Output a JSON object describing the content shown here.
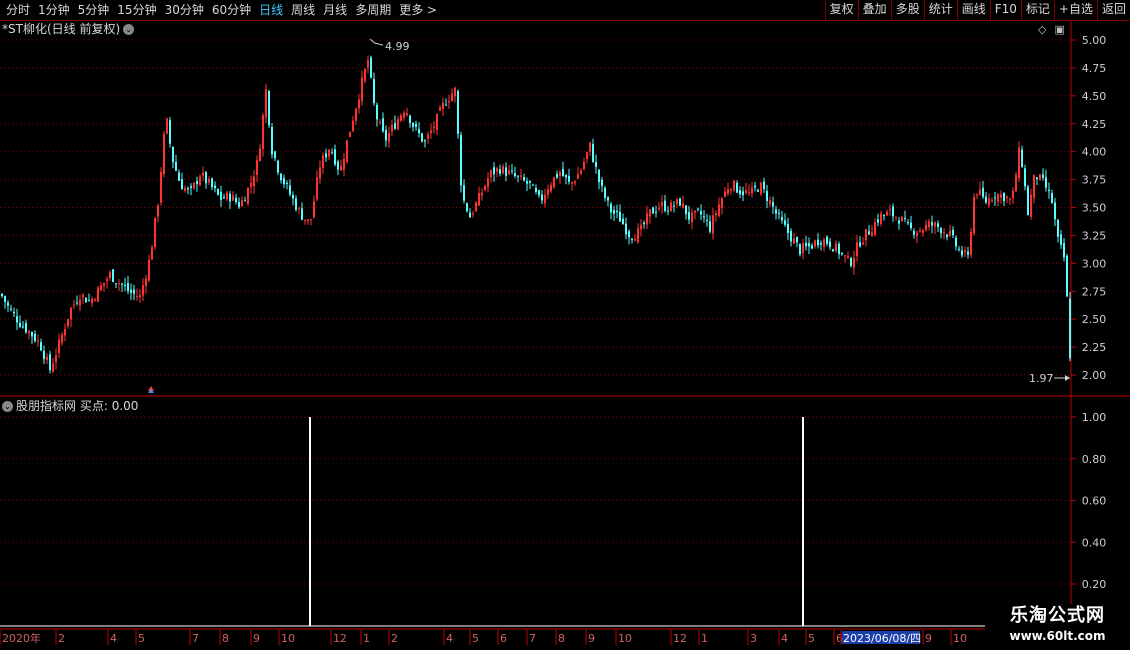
{
  "toolbar": {
    "periods": [
      "分时",
      "1分钟",
      "5分钟",
      "15分钟",
      "30分钟",
      "60分钟",
      "日线",
      "周线",
      "月线",
      "多周期",
      "更多 >"
    ],
    "active": "日线",
    "right_buttons": [
      "复权",
      "叠加",
      "多股",
      "统计",
      "画线",
      "F10",
      "标记",
      "+自选",
      "返回"
    ]
  },
  "main": {
    "title": "*ST柳化(日线 前复权)",
    "chev": "⌄",
    "icons": [
      "diamond-icon",
      "panel-icon"
    ],
    "price_ticks": [
      "5.00",
      "4.75",
      "4.50",
      "4.25",
      "4.00",
      "3.75",
      "3.50",
      "3.25",
      "3.00",
      "2.75",
      "2.50",
      "2.25",
      "2.00"
    ],
    "high_label": "4.99",
    "low_label": "1.97"
  },
  "indicator": {
    "title": "股朋指标网",
    "series_label": "买点: 0.00",
    "ticks": [
      "1.00",
      "0.80",
      "0.60",
      "0.40",
      "0.20"
    ]
  },
  "time_axis": {
    "labels": [
      "2020年",
      "2",
      "4",
      "5",
      "7",
      "8",
      "9",
      "10",
      "12",
      "1",
      "2",
      "4",
      "5",
      "6",
      "7",
      "8",
      "9",
      "10",
      "12",
      "1",
      "3",
      "4",
      "5",
      "6",
      "2023/06/08/四",
      "9",
      "10"
    ]
  },
  "watermark": {
    "line1": "乐淘公式网",
    "line2": "www.60lt.com"
  },
  "colors": {
    "up": "#ff3232",
    "down": "#54ffff",
    "grid": "#8b0000",
    "axis": "#c00000",
    "active": "#3fd0ff"
  },
  "chart_data": {
    "type": "candlestick",
    "ylim": [
      1.97,
      4.99
    ],
    "price_ticks": [
      5.0,
      4.75,
      4.5,
      4.25,
      4.0,
      3.75,
      3.5,
      3.25,
      3.0,
      2.75,
      2.5,
      2.25,
      2.0
    ],
    "close_path": [
      [
        0,
        2.74
      ],
      [
        10,
        2.58
      ],
      [
        20,
        2.47
      ],
      [
        30,
        2.38
      ],
      [
        40,
        2.28
      ],
      [
        50,
        2.05
      ],
      [
        60,
        2.3
      ],
      [
        70,
        2.58
      ],
      [
        80,
        2.72
      ],
      [
        90,
        2.66
      ],
      [
        100,
        2.78
      ],
      [
        110,
        2.9
      ],
      [
        120,
        2.82
      ],
      [
        130,
        2.74
      ],
      [
        140,
        2.7
      ],
      [
        150,
        3.05
      ],
      [
        158,
        3.55
      ],
      [
        166,
        4.32
      ],
      [
        172,
        3.95
      ],
      [
        180,
        3.72
      ],
      [
        190,
        3.62
      ],
      [
        200,
        3.8
      ],
      [
        210,
        3.7
      ],
      [
        220,
        3.58
      ],
      [
        230,
        3.6
      ],
      [
        240,
        3.52
      ],
      [
        250,
        3.7
      ],
      [
        258,
        3.92
      ],
      [
        266,
        4.55
      ],
      [
        272,
        4.02
      ],
      [
        280,
        3.8
      ],
      [
        290,
        3.62
      ],
      [
        300,
        3.45
      ],
      [
        310,
        3.35
      ],
      [
        320,
        3.88
      ],
      [
        330,
        4.05
      ],
      [
        340,
        3.82
      ],
      [
        350,
        4.2
      ],
      [
        360,
        4.55
      ],
      [
        368,
        4.82
      ],
      [
        375,
        4.35
      ],
      [
        385,
        4.1
      ],
      [
        395,
        4.25
      ],
      [
        405,
        4.4
      ],
      [
        415,
        4.2
      ],
      [
        425,
        4.08
      ],
      [
        435,
        4.25
      ],
      [
        445,
        4.45
      ],
      [
        455,
        4.55
      ],
      [
        462,
        3.6
      ],
      [
        470,
        3.42
      ],
      [
        480,
        3.6
      ],
      [
        490,
        3.8
      ],
      [
        500,
        3.85
      ],
      [
        510,
        3.8
      ],
      [
        520,
        3.75
      ],
      [
        530,
        3.7
      ],
      [
        540,
        3.55
      ],
      [
        550,
        3.72
      ],
      [
        560,
        3.82
      ],
      [
        570,
        3.7
      ],
      [
        580,
        3.82
      ],
      [
        590,
        4.05
      ],
      [
        600,
        3.7
      ],
      [
        610,
        3.48
      ],
      [
        620,
        3.4
      ],
      [
        630,
        3.25
      ],
      [
        640,
        3.28
      ],
      [
        650,
        3.45
      ],
      [
        660,
        3.52
      ],
      [
        670,
        3.5
      ],
      [
        680,
        3.55
      ],
      [
        690,
        3.4
      ],
      [
        700,
        3.45
      ],
      [
        710,
        3.32
      ],
      [
        720,
        3.55
      ],
      [
        730,
        3.72
      ],
      [
        740,
        3.65
      ],
      [
        750,
        3.62
      ],
      [
        760,
        3.7
      ],
      [
        770,
        3.55
      ],
      [
        780,
        3.38
      ],
      [
        790,
        3.25
      ],
      [
        800,
        3.12
      ],
      [
        810,
        3.15
      ],
      [
        820,
        3.22
      ],
      [
        830,
        3.18
      ],
      [
        840,
        3.1
      ],
      [
        850,
        3.0
      ],
      [
        860,
        3.2
      ],
      [
        870,
        3.3
      ],
      [
        880,
        3.42
      ],
      [
        890,
        3.45
      ],
      [
        900,
        3.4
      ],
      [
        910,
        3.3
      ],
      [
        920,
        3.3
      ],
      [
        930,
        3.35
      ],
      [
        940,
        3.32
      ],
      [
        950,
        3.25
      ],
      [
        960,
        3.1
      ],
      [
        968,
        3.05
      ],
      [
        975,
        3.68
      ],
      [
        985,
        3.55
      ],
      [
        995,
        3.62
      ],
      [
        1005,
        3.6
      ],
      [
        1012,
        3.55
      ],
      [
        1020,
        4.05
      ],
      [
        1028,
        3.45
      ],
      [
        1035,
        3.8
      ],
      [
        1045,
        3.7
      ],
      [
        1052,
        3.55
      ],
      [
        1058,
        3.2
      ],
      [
        1064,
        3.05
      ],
      [
        1068,
        2.55
      ],
      [
        1071,
        2.0
      ]
    ],
    "signals": [
      {
        "label": "买点",
        "x": 310,
        "value": 1.0
      },
      {
        "label": "买点",
        "x": 803,
        "value": 1.0
      }
    ]
  }
}
